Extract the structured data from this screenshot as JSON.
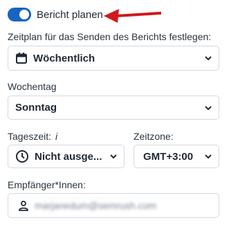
{
  "toggle": {
    "label": "Bericht planen",
    "on": true
  },
  "schedule": {
    "label": "Zeitplan für das Senden des Berichts festlegen:",
    "value": "Wöchentlich",
    "icon": "calendar-icon"
  },
  "weekday": {
    "label": "Wochentag",
    "value": "Sonntag"
  },
  "time_of_day": {
    "label": "Tageszeit:",
    "info": "i",
    "value": "Nicht ausge...",
    "icon": "clock-icon"
  },
  "timezone": {
    "label": "Zeitzone:",
    "value": "GMT+3:00"
  },
  "recipients": {
    "label": "Empfänger*Innen:",
    "value": "marjanedum@semrush.com",
    "icon": "person-icon"
  },
  "colors": {
    "accent": "#1565c0",
    "annotation_arrow": "#d0191d",
    "border": "#d3d9e0"
  }
}
